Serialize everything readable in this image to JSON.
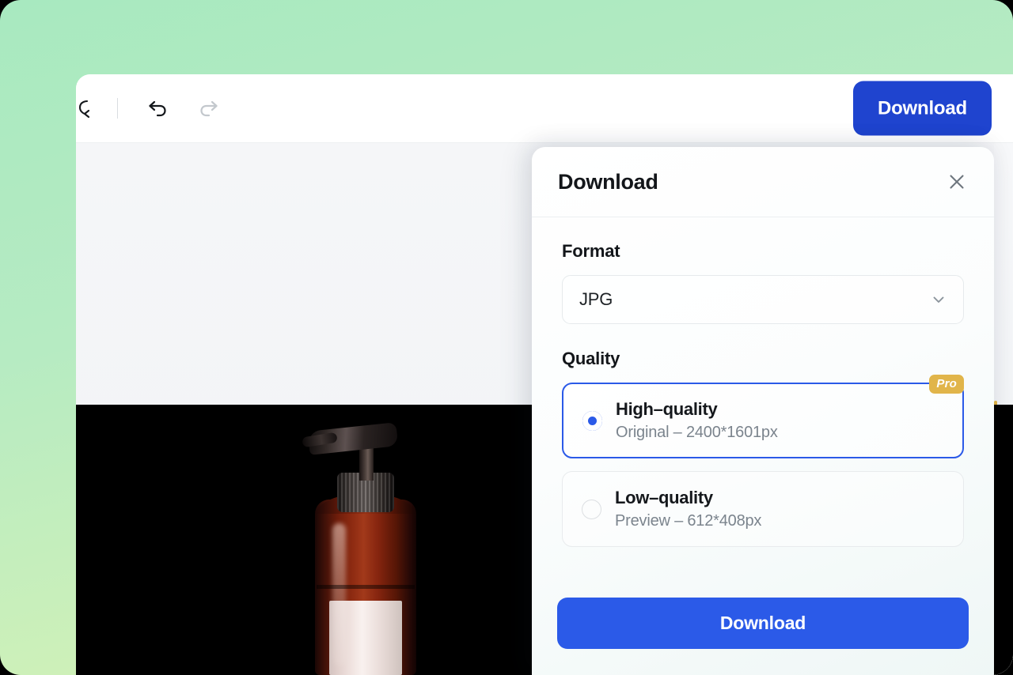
{
  "toolbar": {
    "crop_icon": "crop-icon",
    "undo_icon": "undo-icon",
    "redo_icon": "redo-icon",
    "download_label": "Download"
  },
  "panel": {
    "title": "Download",
    "close_icon": "close-icon",
    "format": {
      "label": "Format",
      "selected": "JPG",
      "chevron_icon": "chevron-down-icon"
    },
    "quality": {
      "label": "Quality",
      "options": [
        {
          "title": "High–quality",
          "subtitle": "Original – 2400*1601px",
          "badge": "Pro",
          "selected": true
        },
        {
          "title": "Low–quality",
          "subtitle": "Preview – 612*408px",
          "badge": null,
          "selected": false
        }
      ]
    },
    "download_label": "Download"
  },
  "colors": {
    "accent_blue": "#2b5ae8",
    "header_blue": "#1f44cf",
    "pro_gold": "#e1b54a",
    "background_start": "#a8e9c0",
    "background_end": "#e0f5b0",
    "image_backdrop": "#000000"
  }
}
